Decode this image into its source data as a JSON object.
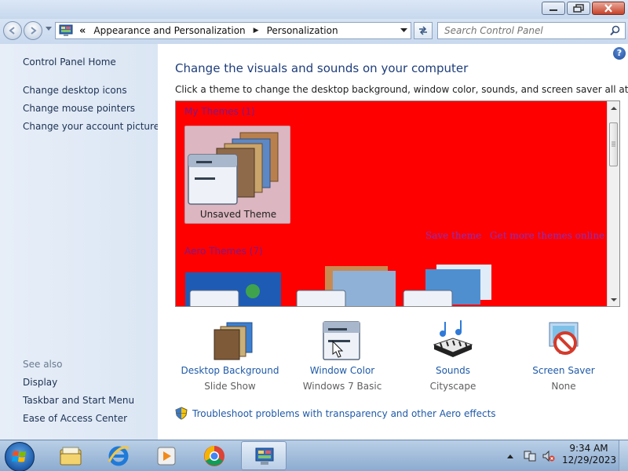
{
  "window": {
    "title": "",
    "minimize_label": "",
    "restore_label": "",
    "close_label": ""
  },
  "address_bar": {
    "root_glyph": "«",
    "crumbs": [
      "Appearance and Personalization",
      "Personalization"
    ],
    "separator": "▶",
    "search_placeholder": "Search Control Panel"
  },
  "sidebar": {
    "home": "Control Panel Home",
    "links": [
      "Change desktop icons",
      "Change mouse pointers",
      "Change your account picture"
    ],
    "see_also_label": "See also",
    "see_also": [
      "Display",
      "Taskbar and Start Menu",
      "Ease of Access Center"
    ]
  },
  "main": {
    "heading": "Change the visuals and sounds on your computer",
    "subtitle": "Click a theme to change the desktop background, window color, sounds, and screen saver all at once.",
    "my_themes_label": "My Themes (1)",
    "unsaved_theme": "Unsaved Theme",
    "save_theme": "Save theme",
    "get_more_online": "Get more themes online",
    "aero_themes_label": "Aero Themes (7)",
    "help": "?"
  },
  "bottom": [
    {
      "link": "Desktop Background",
      "value": "Slide Show",
      "icon": "desktop-background-icon"
    },
    {
      "link": "Window Color",
      "value": "Windows 7 Basic",
      "icon": "window-color-icon"
    },
    {
      "link": "Sounds",
      "value": "Cityscape",
      "icon": "sounds-icon"
    },
    {
      "link": "Screen Saver",
      "value": "None",
      "icon": "screen-saver-icon"
    }
  ],
  "troubleshoot": "Troubleshoot problems with transparency and other Aero effects",
  "taskbar": {
    "apps": [
      "start-button",
      "file-explorer",
      "internet-explorer",
      "media-player",
      "chrome",
      "control-panel"
    ],
    "time": "9:34 AM",
    "date": "12/29/2023"
  },
  "colors": {
    "theme_area_bg": "#ff0000",
    "link_blue": "#1f5aa8",
    "heading_blue": "#1e3d7b",
    "pink_link": "#8a2fbf"
  }
}
